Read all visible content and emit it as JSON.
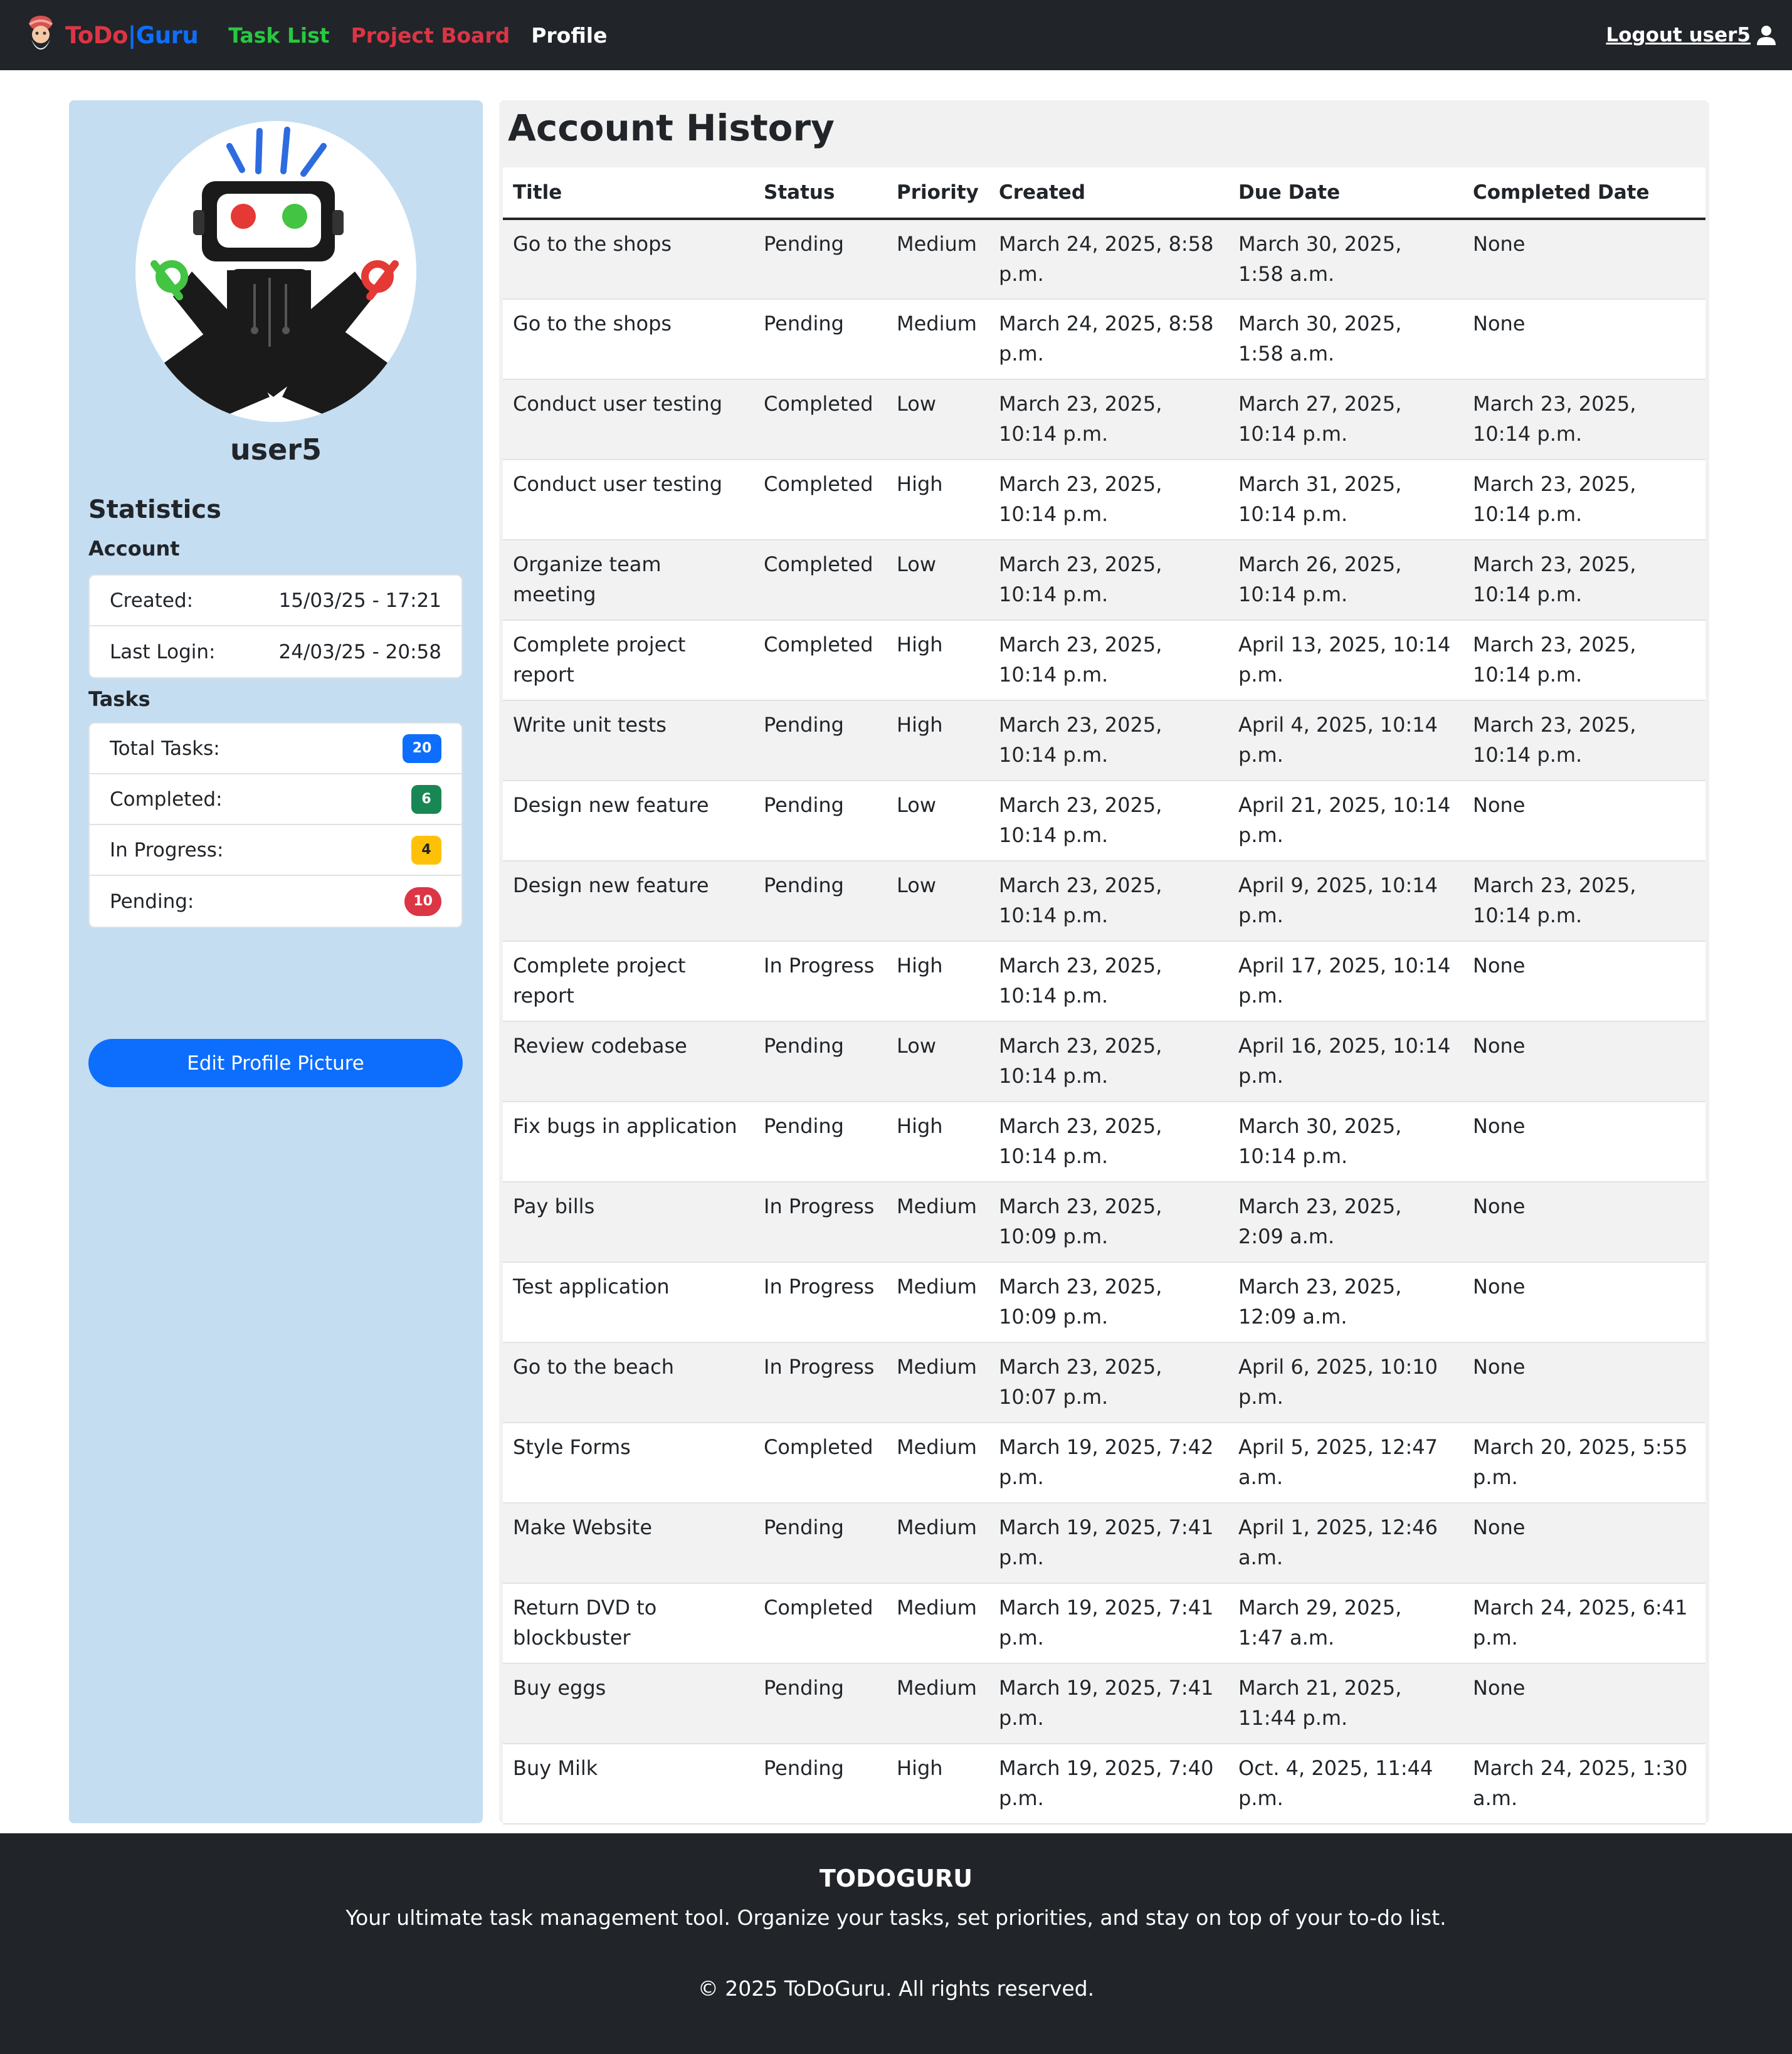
{
  "nav": {
    "brand": {
      "to": "ToDo",
      "sep": "|",
      "guru": "Guru"
    },
    "links": [
      "Task List",
      "Project Board",
      "Profile"
    ],
    "logout": "Logout user5"
  },
  "profile": {
    "username": "user5",
    "statistics_title": "Statistics",
    "account_label": "Account",
    "created_label": "Created:",
    "created_value": "15/03/25 - 17:21",
    "last_login_label": "Last Login:",
    "last_login_value": "24/03/25 - 20:58",
    "tasks_label": "Tasks",
    "total_label": "Total Tasks:",
    "total_value": "20",
    "completed_label": "Completed:",
    "completed_value": "6",
    "in_progress_label": "In Progress:",
    "in_progress_value": "4",
    "pending_label": "Pending:",
    "pending_value": "10",
    "edit_button": "Edit Profile Picture"
  },
  "colors": {
    "primary": "#0d6efd",
    "success": "#198754",
    "warning": "#ffc107",
    "danger": "#dc3545",
    "navbar": "#212529",
    "sidebar": "#c5ddf1"
  },
  "history": {
    "title": "Account History",
    "columns": [
      "Title",
      "Status",
      "Priority",
      "Created",
      "Due Date",
      "Completed Date"
    ],
    "rows": [
      [
        "Go to the shops",
        "Pending",
        "Medium",
        "March 24, 2025, 8:58 p.m.",
        "March 30, 2025, 1:58 a.m.",
        "None"
      ],
      [
        "Go to the shops",
        "Pending",
        "Medium",
        "March 24, 2025, 8:58 p.m.",
        "March 30, 2025, 1:58 a.m.",
        "None"
      ],
      [
        "Conduct user testing",
        "Completed",
        "Low",
        "March 23, 2025, 10:14 p.m.",
        "March 27, 2025, 10:14 p.m.",
        "March 23, 2025, 10:14 p.m."
      ],
      [
        "Conduct user testing",
        "Completed",
        "High",
        "March 23, 2025, 10:14 p.m.",
        "March 31, 2025, 10:14 p.m.",
        "March 23, 2025, 10:14 p.m."
      ],
      [
        "Organize team meeting",
        "Completed",
        "Low",
        "March 23, 2025, 10:14 p.m.",
        "March 26, 2025, 10:14 p.m.",
        "March 23, 2025, 10:14 p.m."
      ],
      [
        "Complete project report",
        "Completed",
        "High",
        "March 23, 2025, 10:14 p.m.",
        "April 13, 2025, 10:14 p.m.",
        "March 23, 2025, 10:14 p.m."
      ],
      [
        "Write unit tests",
        "Pending",
        "High",
        "March 23, 2025, 10:14 p.m.",
        "April 4, 2025, 10:14 p.m.",
        "March 23, 2025, 10:14 p.m."
      ],
      [
        "Design new feature",
        "Pending",
        "Low",
        "March 23, 2025, 10:14 p.m.",
        "April 21, 2025, 10:14 p.m.",
        "None"
      ],
      [
        "Design new feature",
        "Pending",
        "Low",
        "March 23, 2025, 10:14 p.m.",
        "April 9, 2025, 10:14 p.m.",
        "March 23, 2025, 10:14 p.m."
      ],
      [
        "Complete project report",
        "In Progress",
        "High",
        "March 23, 2025, 10:14 p.m.",
        "April 17, 2025, 10:14 p.m.",
        "None"
      ],
      [
        "Review codebase",
        "Pending",
        "Low",
        "March 23, 2025, 10:14 p.m.",
        "April 16, 2025, 10:14 p.m.",
        "None"
      ],
      [
        "Fix bugs in application",
        "Pending",
        "High",
        "March 23, 2025, 10:14 p.m.",
        "March 30, 2025, 10:14 p.m.",
        "None"
      ],
      [
        "Pay bills",
        "In Progress",
        "Medium",
        "March 23, 2025, 10:09 p.m.",
        "March 23, 2025, 2:09 a.m.",
        "None"
      ],
      [
        "Test application",
        "In Progress",
        "Medium",
        "March 23, 2025, 10:09 p.m.",
        "March 23, 2025, 12:09 a.m.",
        "None"
      ],
      [
        "Go to the beach",
        "In Progress",
        "Medium",
        "March 23, 2025, 10:07 p.m.",
        "April 6, 2025, 10:10 p.m.",
        "None"
      ],
      [
        "Style Forms",
        "Completed",
        "Medium",
        "March 19, 2025, 7:42 p.m.",
        "April 5, 2025, 12:47 a.m.",
        "March 20, 2025, 5:55 p.m."
      ],
      [
        "Make Website",
        "Pending",
        "Medium",
        "March 19, 2025, 7:41 p.m.",
        "April 1, 2025, 12:46 a.m.",
        "None"
      ],
      [
        "Return DVD to blockbuster",
        "Completed",
        "Medium",
        "March 19, 2025, 7:41 p.m.",
        "March 29, 2025, 1:47 a.m.",
        "March 24, 2025, 6:41 p.m."
      ],
      [
        "Buy eggs",
        "Pending",
        "Medium",
        "March 19, 2025, 7:41 p.m.",
        "March 21, 2025, 11:44 p.m.",
        "None"
      ],
      [
        "Buy Milk",
        "Pending",
        "High",
        "March 19, 2025, 7:40 p.m.",
        "Oct. 4, 2025, 11:44 p.m.",
        "March 24, 2025, 1:30 a.m."
      ]
    ]
  },
  "footer": {
    "title": "TODOGURU",
    "tagline": "Your ultimate task management tool. Organize your tasks, set priorities, and stay on top of your to-do list.",
    "copyright": "© 2025 ToDoGuru. All rights reserved."
  }
}
